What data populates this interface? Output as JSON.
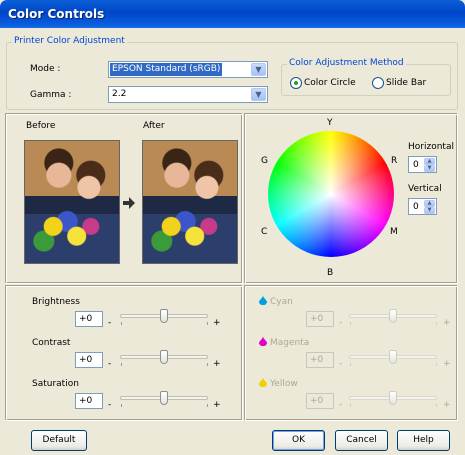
{
  "window": {
    "title": "Color Controls"
  },
  "printer_adjustment": {
    "legend": "Printer Color Adjustment",
    "mode": {
      "label": "Mode :",
      "value": "EPSON Standard (sRGB)"
    },
    "gamma": {
      "label": "Gamma :",
      "value": "2.2"
    }
  },
  "method": {
    "legend": "Color Adjustment Method",
    "options": [
      {
        "label": "Color Circle",
        "selected": true
      },
      {
        "label": "Slide Bar",
        "selected": false
      }
    ]
  },
  "preview": {
    "before": "Before",
    "after": "After",
    "arrow_icon": "right-arrow-icon"
  },
  "color_circle": {
    "labels": {
      "top": "Y",
      "upper_left": "G",
      "upper_right": "R",
      "lower_left": "C",
      "lower_right": "M",
      "bottom": "B"
    },
    "horizontal": {
      "label": "Horizontal",
      "value": "0"
    },
    "vertical": {
      "label": "Vertical",
      "value": "0"
    }
  },
  "sliders_left": [
    {
      "label": "Brightness",
      "value": "+0",
      "minus": "-",
      "plus": "+",
      "level": 0.5
    },
    {
      "label": "Contrast",
      "value": "+0",
      "minus": "-",
      "plus": "+",
      "level": 0.5
    },
    {
      "label": "Saturation",
      "value": "+0",
      "minus": "-",
      "plus": "+",
      "level": 0.5
    }
  ],
  "sliders_right": [
    {
      "label": "Cyan",
      "value": "+0",
      "minus": "-",
      "plus": "+",
      "level": 0.5,
      "drop_color": "#00a0e0",
      "enabled": false
    },
    {
      "label": "Magenta",
      "value": "+0",
      "minus": "-",
      "plus": "+",
      "level": 0.5,
      "drop_color": "#e000c8",
      "enabled": false
    },
    {
      "label": "Yellow",
      "value": "+0",
      "minus": "-",
      "plus": "+",
      "level": 0.5,
      "drop_color": "#f0d000",
      "enabled": false
    }
  ],
  "buttons": {
    "default": "Default",
    "ok": "OK",
    "cancel": "Cancel",
    "help": "Help"
  },
  "colors": {
    "title_bar": "#0046c8",
    "legend_text": "#0046d5",
    "dialog_bg": "#ece9d8",
    "selection": "#316ac5"
  }
}
